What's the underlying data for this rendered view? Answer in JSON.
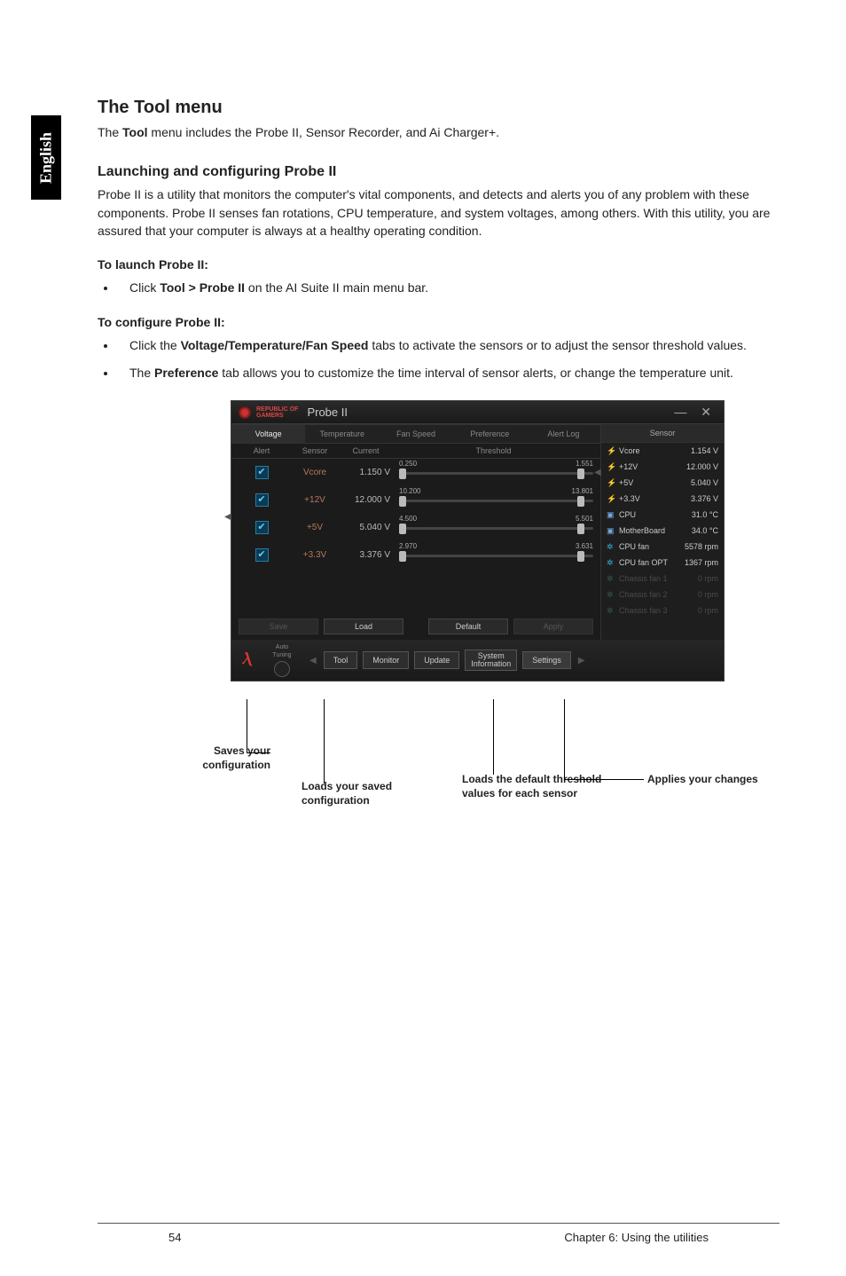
{
  "sideTab": "English",
  "h2": "The Tool menu",
  "intro_pre": "The ",
  "intro_bold": "Tool",
  "intro_post": " menu includes the Probe II, Sensor Recorder, and Ai Charger+.",
  "h3": "Launching and configuring Probe II",
  "para1": "Probe II is a utility that monitors the computer's vital components, and detects and alerts you of any problem with these components. Probe II senses fan rotations, CPU temperature, and system voltages, among others. With this utility, you are assured that your computer is always at a healthy operating condition.",
  "launch_h": "To launch Probe II:",
  "launch_li_pre": "Click ",
  "launch_li_bold": "Tool > Probe II",
  "launch_li_post": " on the AI Suite II main menu bar.",
  "config_h": "To configure Probe II:",
  "config_li1_pre": "Click the ",
  "config_li1_bold": "Voltage/Temperature/Fan Speed",
  "config_li1_post": " tabs to activate the sensors or to adjust the sensor threshold values.",
  "config_li2_pre": "The ",
  "config_li2_bold": "Preference",
  "config_li2_post": " tab allows you to customize the time interval of sensor alerts, or change the temperature unit.",
  "probe": {
    "brand_line1": "REPUBLIC OF",
    "brand_line2": "GAMERS",
    "title": "Probe II",
    "tabs": [
      "Voltage",
      "Temperature",
      "Fan Speed",
      "Preference",
      "Alert Log"
    ],
    "head": {
      "alert": "Alert",
      "sensor": "Sensor",
      "current": "Current",
      "threshold": "Threshold"
    },
    "rows": [
      {
        "sensor": "Vcore",
        "current": "1.150 V",
        "lo": "0.250",
        "hi": "1.551"
      },
      {
        "sensor": "+12V",
        "current": "12.000 V",
        "lo": "10.200",
        "hi": "13.801"
      },
      {
        "sensor": "+5V",
        "current": "5.040 V",
        "lo": "4.500",
        "hi": "5.501"
      },
      {
        "sensor": "+3.3V",
        "current": "3.376 V",
        "lo": "2.970",
        "hi": "3.631"
      }
    ],
    "btns": {
      "save": "Save",
      "load": "Load",
      "default": "Default",
      "apply": "Apply"
    },
    "rightHead": "Sensor",
    "sensors": [
      {
        "icon": "bolt",
        "name": "Vcore",
        "val": "1.154 V"
      },
      {
        "icon": "bolt",
        "name": "+12V",
        "val": "12.000 V"
      },
      {
        "icon": "bolt",
        "name": "+5V",
        "val": "5.040 V"
      },
      {
        "icon": "bolt",
        "name": "+3.3V",
        "val": "3.376 V"
      },
      {
        "icon": "chip",
        "name": "CPU",
        "val": "31.0 °C"
      },
      {
        "icon": "chip",
        "name": "MotherBoard",
        "val": "34.0 °C"
      },
      {
        "icon": "fan",
        "name": "CPU fan",
        "val": "5578 rpm"
      },
      {
        "icon": "fan",
        "name": "CPU fan OPT",
        "val": "1367 rpm"
      },
      {
        "icon": "fan-dim",
        "name": "Chassis fan 1",
        "val": "0 rpm",
        "dim": true
      },
      {
        "icon": "fan-dim",
        "name": "Chassis fan 2",
        "val": "0 rpm",
        "dim": true
      },
      {
        "icon": "fan-dim",
        "name": "Chassis fan 3",
        "val": "0 rpm",
        "dim": true
      }
    ],
    "bottom": {
      "auto_l1": "Auto",
      "auto_l2": "Tuning",
      "tool": "Tool",
      "monitor": "Monitor",
      "update": "Update",
      "sysinfo": "System\nInformation",
      "settings": "Settings"
    }
  },
  "callouts": {
    "save": "Saves your configuration",
    "load": "Loads your saved configuration",
    "default": "Loads the default threshold values for each sensor",
    "apply": "Applies your changes"
  },
  "footer": {
    "page": "54",
    "chapter": "Chapter 6: Using the utilities"
  }
}
